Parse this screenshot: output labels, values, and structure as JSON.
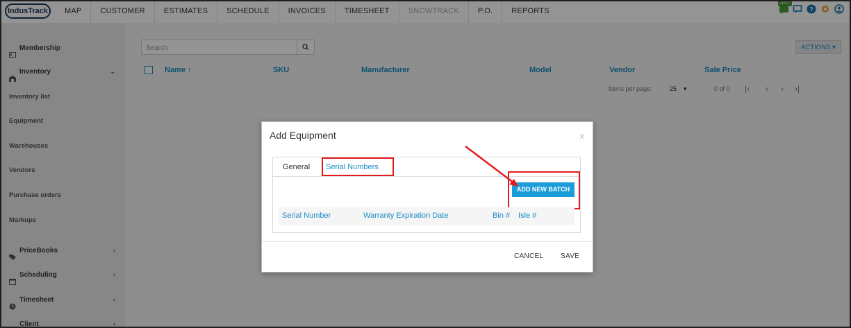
{
  "app": {
    "logo": "IndusTrack"
  },
  "nav": [
    "MAP",
    "CUSTOMER",
    "ESTIMATES",
    "SCHEDULE",
    "INVOICES",
    "TIMESHEET",
    "SNOWTRACK",
    "P.O.",
    "REPORTS"
  ],
  "header_badge": "2017",
  "sidebar": {
    "membership": "Membership",
    "inventory": "Inventory",
    "inventory_items": [
      "Inventory list",
      "Equipment",
      "Warehouses",
      "Vendors",
      "Purchase orders",
      "Markups"
    ],
    "pricebooks": "PriceBooks",
    "scheduling": "Scheduling",
    "timesheet": "Timesheet",
    "client": "Client"
  },
  "search": {
    "placeholder": "Search"
  },
  "actions_label": "ACTIONS",
  "table": {
    "columns": [
      "Name",
      "SKU",
      "Manufacturer",
      "Model",
      "Vendor",
      "Sale Price"
    ],
    "sort_icon": "↑"
  },
  "pager": {
    "items_per_page_label": "Items per page:",
    "items_per_page": "25",
    "range": "0 of 0"
  },
  "modal": {
    "title": "Add Equipment",
    "close": "x",
    "tabs": [
      "General",
      "Serial Numbers"
    ],
    "add_batch_label": "ADD NEW BATCH",
    "serial_columns": [
      "Serial Number",
      "Warranty Expiration Date",
      "Bin #",
      "Isle #"
    ],
    "cancel_label": "CANCEL",
    "save_label": "SAVE"
  },
  "colors": {
    "accent": "#1a8bc5",
    "highlight": "#e41b1b",
    "button": "#1a9dd9"
  }
}
